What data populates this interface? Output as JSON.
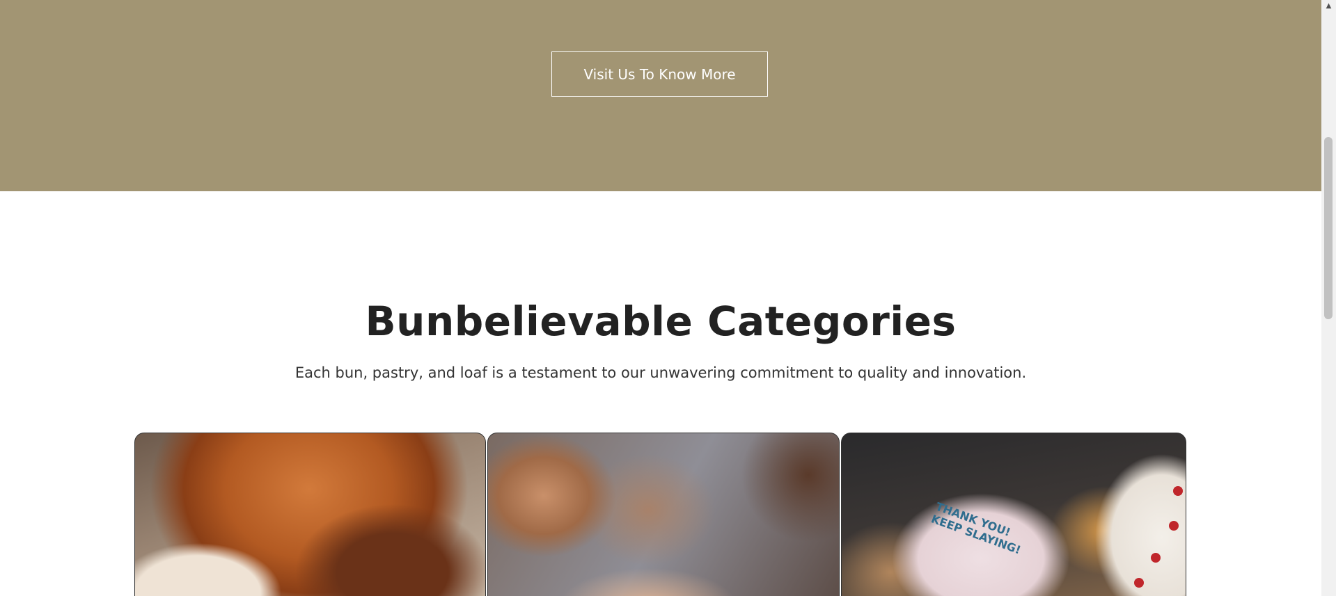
{
  "hero": {
    "cta_label": "Visit Us To Know More",
    "background_color": "#a29573"
  },
  "categories": {
    "title": "Bunbelievable Categories",
    "subtitle": "Each bun, pastry, and loaf is a testament to our unwavering commitment to quality and innovation.",
    "cards": [
      {
        "image": "pastries-croissant-cinnamon-roll"
      },
      {
        "image": "blurred-donuts"
      },
      {
        "image": "bento-cake-thank-you",
        "cake_text": "THANK YOU! KEEP SLAYING!"
      }
    ]
  },
  "scrollbar": {
    "up_icon": "triangle-up-icon"
  }
}
